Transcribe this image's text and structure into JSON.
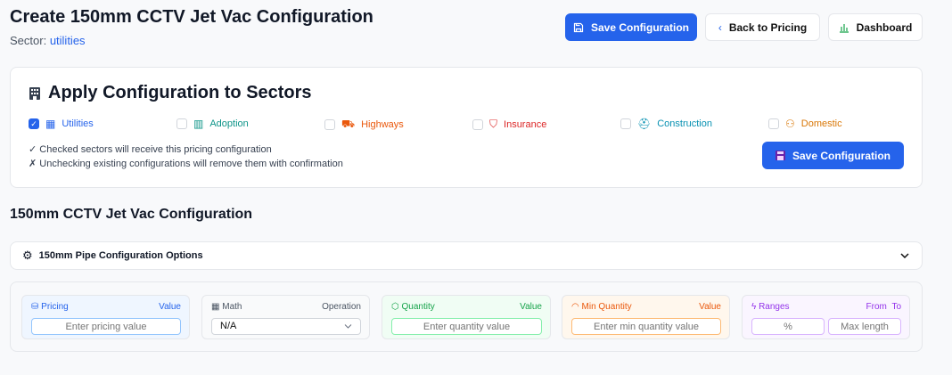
{
  "header": {
    "title": "Create 150mm CCTV Jet Vac Configuration",
    "sector_label": "Sector:",
    "sector_value": "utilities",
    "save_label": "Save Configuration",
    "back_label": "Back to Pricing",
    "dashboard_label": "Dashboard"
  },
  "sectors_card": {
    "title": "Apply Configuration to Sectors",
    "items": [
      {
        "label": "Utilities",
        "checked": true,
        "color": "#2563eb",
        "icon": "building-icon"
      },
      {
        "label": "Adoption",
        "checked": false,
        "color": "#0d9488",
        "icon": "buildings-icon"
      },
      {
        "label": "Highways",
        "checked": false,
        "color": "#ea580c",
        "icon": "truck-icon"
      },
      {
        "label": "Insurance",
        "checked": false,
        "color": "#dc2626",
        "icon": "shield-icon"
      },
      {
        "label": "Construction",
        "checked": false,
        "color": "#0891b2",
        "icon": "hard-hat-icon"
      },
      {
        "label": "Domestic",
        "checked": false,
        "color": "#d97706",
        "icon": "users-icon"
      }
    ],
    "note_checked": "✓ Checked sectors will receive this pricing configuration",
    "note_unchecked": "✗ Unchecking existing configurations will remove them with confirmation",
    "save_label": "Save Configuration"
  },
  "section_title": "150mm CCTV Jet Vac Configuration",
  "accordion": {
    "label": "150mm Pipe Configuration Options"
  },
  "config": {
    "pricing": {
      "label": "Pricing",
      "right": "Value",
      "placeholder": "Enter pricing value"
    },
    "math": {
      "label": "Math",
      "right": "Operation",
      "value": "N/A"
    },
    "quantity": {
      "label": "Quantity",
      "right": "Value",
      "placeholder": "Enter quantity value"
    },
    "min_quantity": {
      "label": "Min Quantity",
      "right": "Value",
      "placeholder": "Enter min quantity value"
    },
    "ranges": {
      "label": "Ranges",
      "right_from": "From",
      "right_to": "To",
      "from_placeholder": "%",
      "to_placeholder": "Max length"
    }
  }
}
